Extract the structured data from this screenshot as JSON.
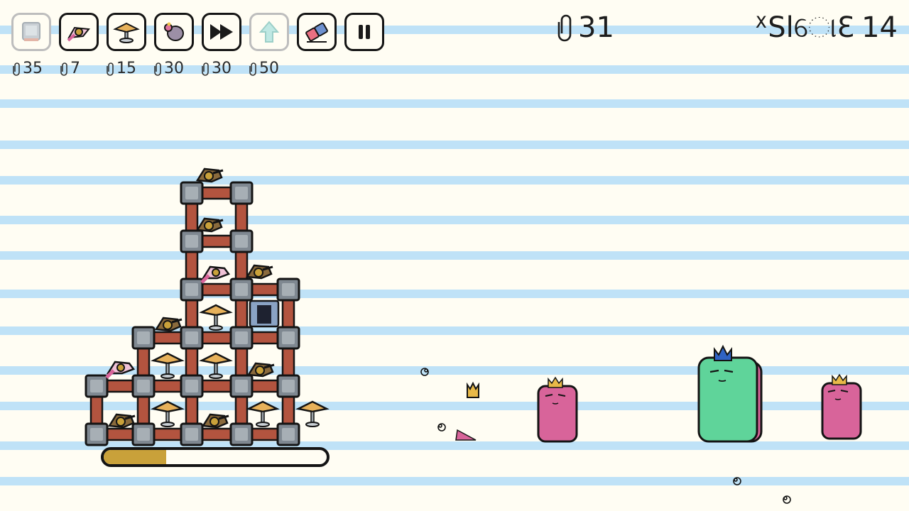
{
  "toolbar": {
    "tools": [
      {
        "name": "block",
        "cost": "35",
        "enabled": false,
        "icon": "block-icon"
      },
      {
        "name": "turret",
        "cost": "7",
        "enabled": true,
        "icon": "turret-icon"
      },
      {
        "name": "spring",
        "cost": "15",
        "enabled": true,
        "icon": "spring-icon"
      },
      {
        "name": "bomb",
        "cost": "30",
        "enabled": true,
        "icon": "bomb-icon"
      },
      {
        "name": "fast-forward",
        "cost": "30",
        "enabled": true,
        "icon": "fast-forward-icon"
      },
      {
        "name": "upgrade",
        "cost": "50",
        "enabled": false,
        "icon": "up-arrow-icon"
      },
      {
        "name": "eraser",
        "cost": null,
        "enabled": true,
        "icon": "eraser-icon"
      },
      {
        "name": "pause",
        "cost": null,
        "enabled": true,
        "icon": "pause-icon"
      }
    ]
  },
  "hud": {
    "paperclips": "31",
    "wave_label": "ᕽSlୋƐ",
    "wave_number": "14"
  },
  "tower": {
    "health_fraction": 0.28
  },
  "enemies": [
    {
      "type": "small-pink-king",
      "crown": "gold"
    },
    {
      "type": "big-green-king",
      "crown": "blue"
    },
    {
      "type": "small-pink-king",
      "crown": "gold"
    }
  ],
  "colors": {
    "line": "#bfe2f7",
    "paper": "#fffdf3",
    "pink_enemy": "#d8649a",
    "green_enemy": "#5fd49a",
    "brick": "#b3543f",
    "block": "#8e979e",
    "health": "#c9a13a"
  }
}
